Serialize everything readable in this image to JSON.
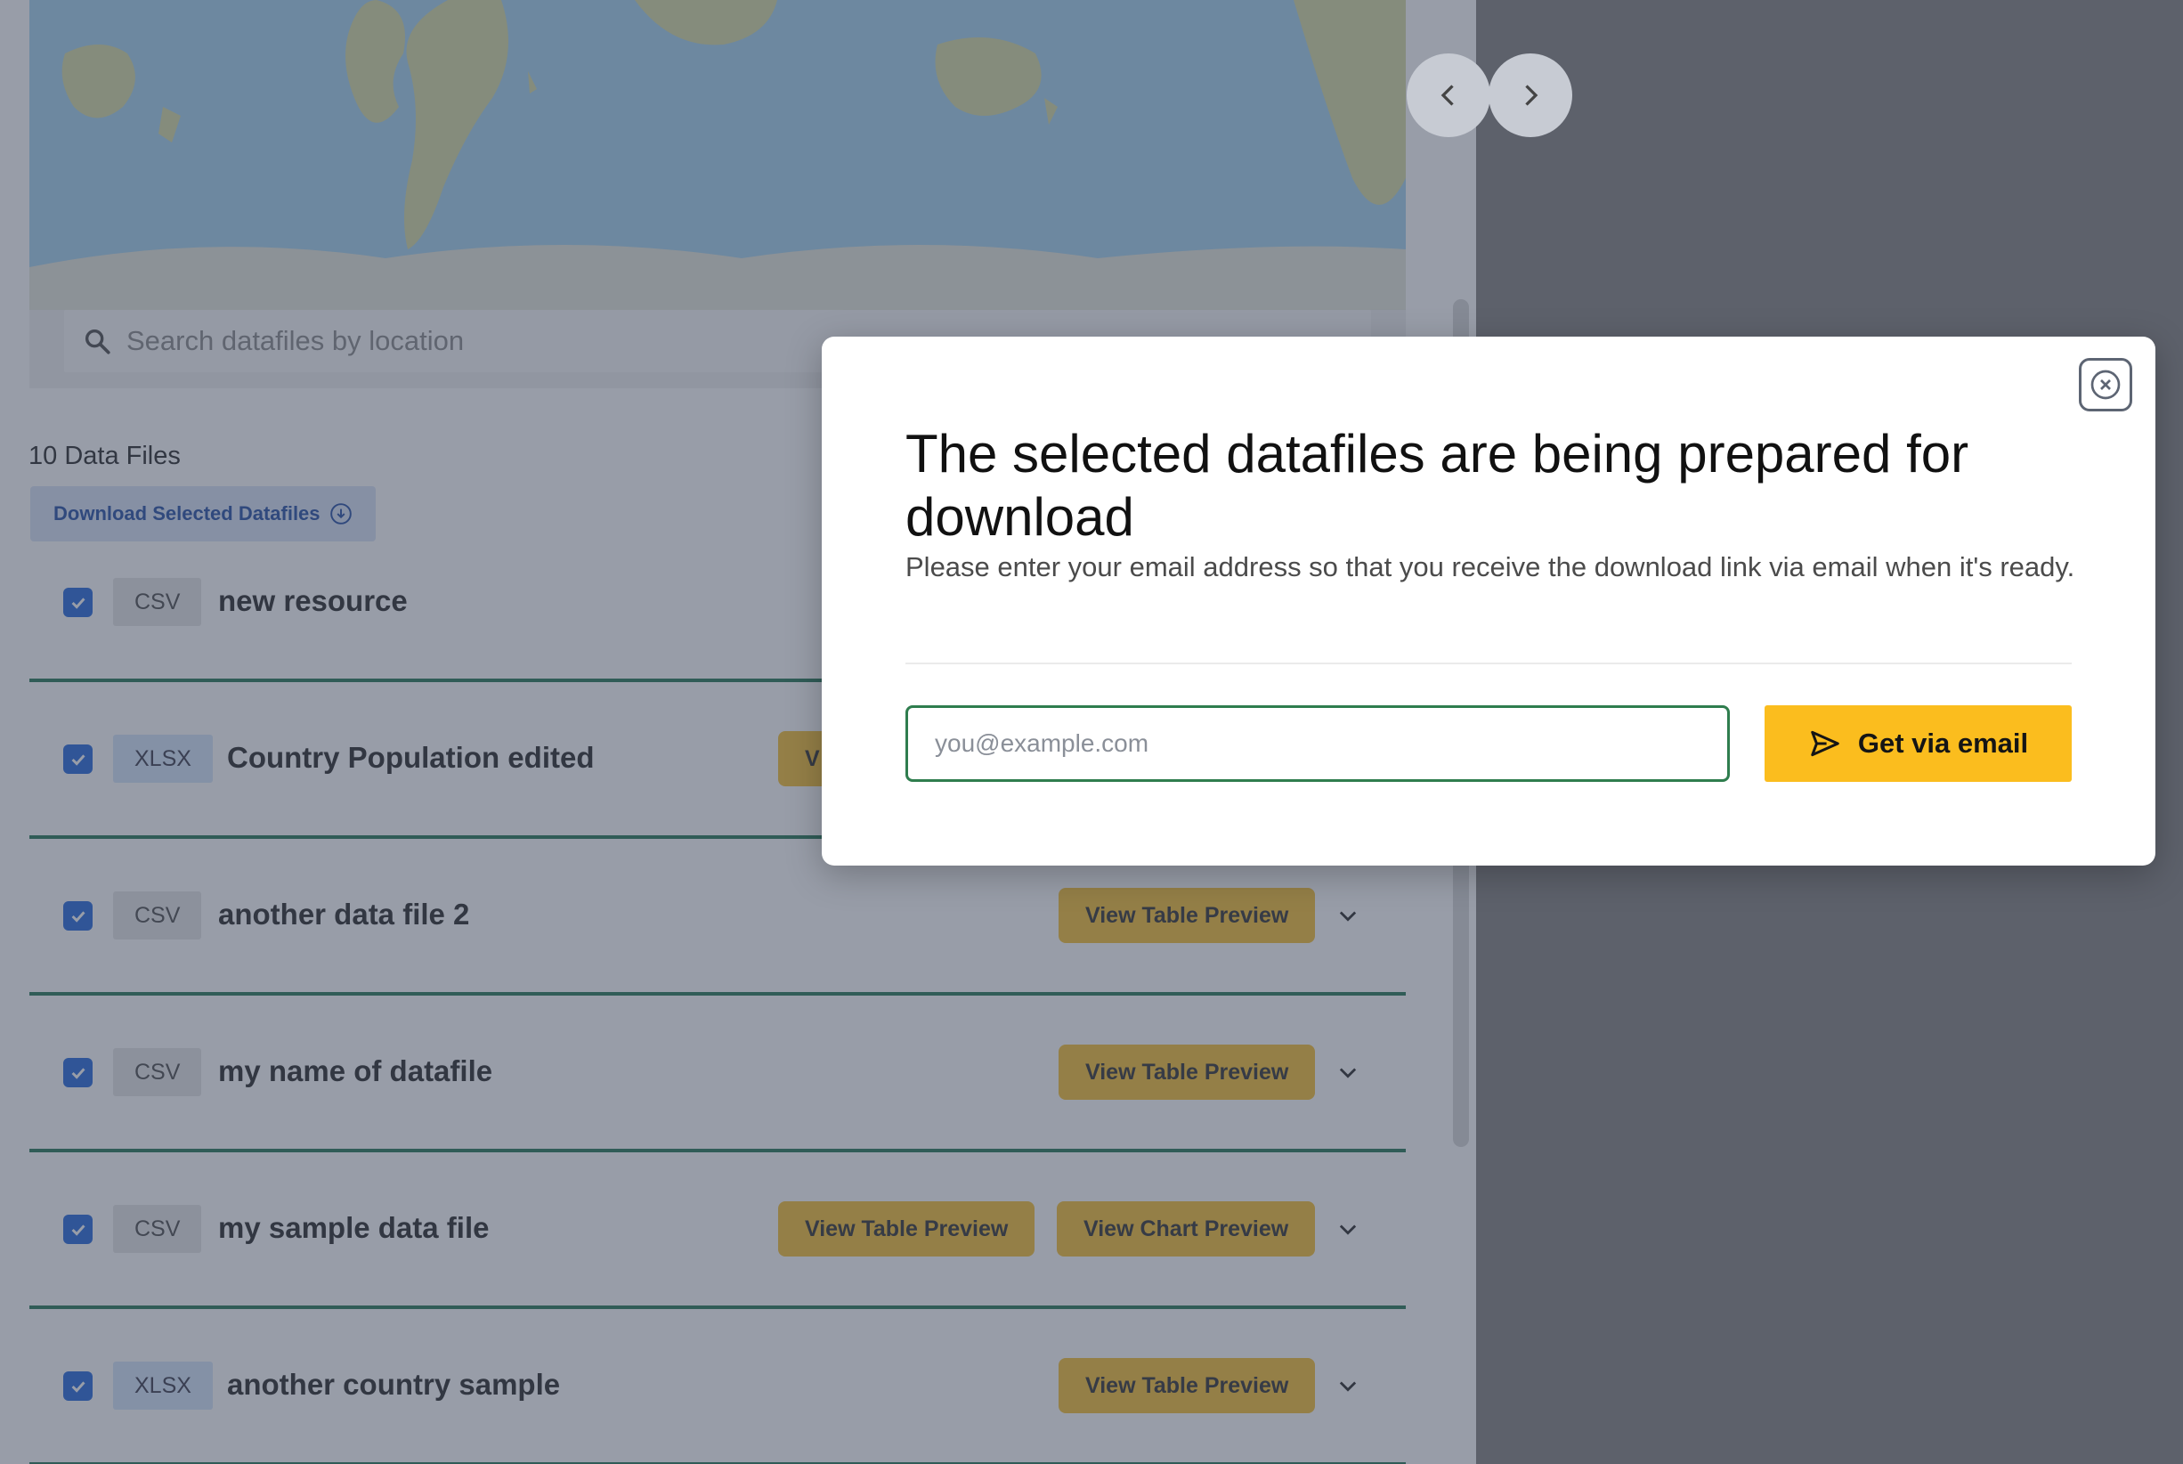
{
  "search": {
    "placeholder": "Search datafiles by location"
  },
  "list": {
    "count_label": "10 Data Files",
    "download_selected_label": "Download Selected Datafiles"
  },
  "files": [
    {
      "format": "CSV",
      "name": "new resource",
      "buttons": []
    },
    {
      "format": "XLSX",
      "name": "Country Population edited",
      "buttons": [
        "V"
      ]
    },
    {
      "format": "CSV",
      "name": "another data file 2",
      "buttons": [
        "View Table Preview"
      ]
    },
    {
      "format": "CSV",
      "name": "my name of datafile",
      "buttons": [
        "View Table Preview"
      ]
    },
    {
      "format": "CSV",
      "name": "my sample data file",
      "buttons": [
        "View Table Preview",
        "View Chart Preview"
      ]
    },
    {
      "format": "XLSX",
      "name": "another country sample",
      "buttons": [
        "View Table Preview"
      ]
    }
  ],
  "modal": {
    "title": "The selected datafiles are being prepared for download",
    "description": "Please enter your email address so that you receive the download link via email when it's ready.",
    "email_placeholder": "you@example.com",
    "email_value": "",
    "submit_label": "Get via email"
  },
  "colors": {
    "accent_yellow": "#fbbd1e",
    "preview_button": "#f6c33c",
    "checkbox_blue": "#2e6fdc",
    "row_border_green": "#2f7d5c",
    "input_border_green": "#2f7d4e",
    "right_panel": "#5d616b"
  },
  "icons": {
    "search": "search-icon",
    "download": "download-circle-icon",
    "chevron": "chevron-down-icon",
    "close": "close-icon",
    "send": "send-icon",
    "prev": "chevron-left-icon",
    "next": "chevron-right-icon"
  }
}
